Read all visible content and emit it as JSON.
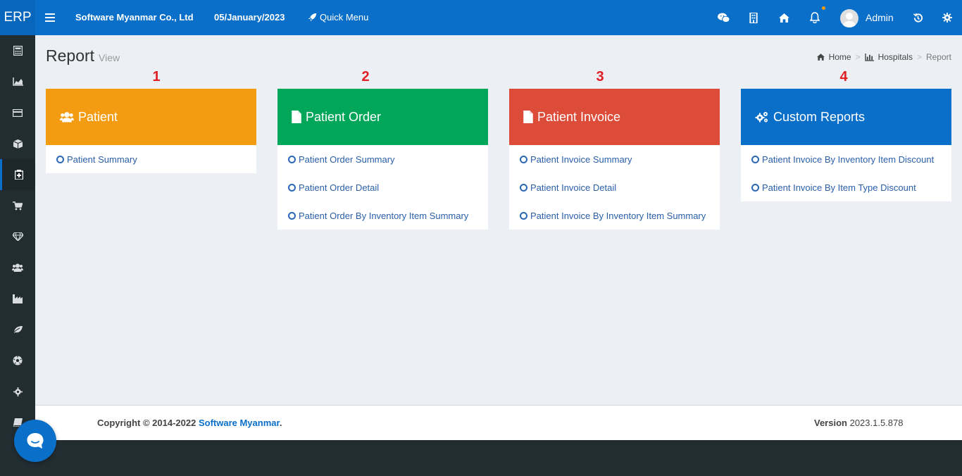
{
  "app": {
    "logo": "ERP",
    "company": "Software Myanmar Co., Ltd",
    "date": "05/January/2023",
    "quick_menu": "Quick Menu",
    "user": "Admin",
    "brand_color": "#0a6fc9"
  },
  "topbar_icons": [
    "wechat-icon",
    "building-icon",
    "home-icon",
    "bell-icon",
    "history-icon",
    "gear-icon"
  ],
  "sidebar": {
    "items": [
      {
        "icon": "calculator-icon"
      },
      {
        "icon": "area-chart-icon"
      },
      {
        "icon": "credit-card-icon"
      },
      {
        "icon": "cube-icon"
      },
      {
        "icon": "hospital-icon",
        "active": true
      },
      {
        "icon": "cart-icon"
      },
      {
        "icon": "diamond-icon"
      },
      {
        "icon": "users-icon"
      },
      {
        "icon": "industry-icon"
      },
      {
        "icon": "leaf-icon"
      },
      {
        "icon": "soccer-icon"
      },
      {
        "icon": "gear-icon"
      },
      {
        "icon": "book-icon"
      }
    ]
  },
  "page": {
    "title": "Report",
    "subtitle": "View"
  },
  "breadcrumb": {
    "home": "Home",
    "section": "Hospitals",
    "current": "Report",
    "separator": ">"
  },
  "cards": [
    {
      "number": "1",
      "title": "Patient",
      "color": "#f39c12",
      "links": [
        "Patient Summary"
      ]
    },
    {
      "number": "2",
      "title": "Patient Order",
      "color": "#00a65a",
      "links": [
        "Patient Order Summary",
        "Patient Order Detail",
        "Patient Order By Inventory Item Summary"
      ]
    },
    {
      "number": "3",
      "title": "Patient Invoice",
      "color": "#dd4b39",
      "links": [
        "Patient Invoice Summary",
        "Patient Invoice Detail",
        "Patient Invoice By Inventory Item Summary"
      ]
    },
    {
      "number": "4",
      "title": "Custom Reports",
      "color": "#0a6fc9",
      "links": [
        "Patient Invoice By Inventory Item Discount",
        "Patient Invoice By Item Type Discount"
      ]
    }
  ],
  "footer": {
    "copyright": "Copyright © 2014-2022 ",
    "company_link": "Software Myanmar",
    "period": ".",
    "version_label": "Version",
    "version": "2023.1.5.878"
  }
}
